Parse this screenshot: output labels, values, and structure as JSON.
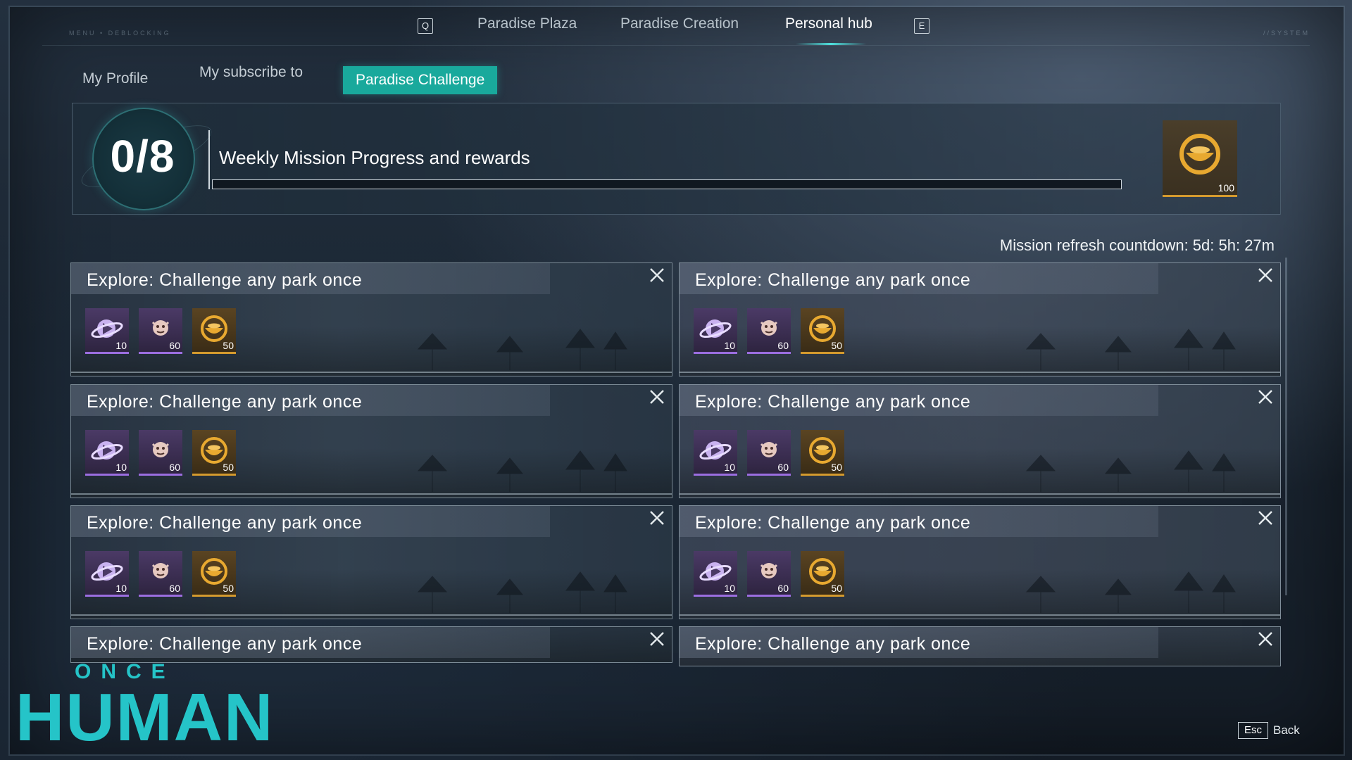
{
  "frame": {
    "left_tag": "MENU • DEBLOCKING",
    "right_tag": "//SYSTEM"
  },
  "top_nav": {
    "left_key": "Q",
    "right_key": "E",
    "tabs": [
      {
        "label": "Paradise Plaza",
        "active": false
      },
      {
        "label": "Paradise Creation",
        "active": false
      },
      {
        "label": "Personal hub",
        "active": true
      }
    ]
  },
  "sub_tabs": [
    {
      "label": "My Profile",
      "active": false
    },
    {
      "label": "My subscribe to",
      "active": false
    },
    {
      "label": "Paradise Challenge",
      "active": true
    }
  ],
  "weekly": {
    "count": "0/8",
    "completed": 0,
    "total": 8,
    "title": "Weekly Mission Progress and rewards",
    "reward_qty": "100",
    "reward_icon": "gold-coin-bowl-icon"
  },
  "countdown": "Mission refresh countdown: 5d: 5h: 27m",
  "missions": [
    {
      "title": "Explore: Challenge any park once",
      "rewards": [
        {
          "icon": "planet-play-icon",
          "qty": "10"
        },
        {
          "icon": "deviant-face-icon",
          "qty": "60"
        },
        {
          "icon": "gold-coin-bowl-icon",
          "qty": "50"
        }
      ]
    },
    {
      "title": "Explore: Challenge any park once",
      "rewards": [
        {
          "icon": "planet-play-icon",
          "qty": "10"
        },
        {
          "icon": "deviant-face-icon",
          "qty": "60"
        },
        {
          "icon": "gold-coin-bowl-icon",
          "qty": "50"
        }
      ]
    },
    {
      "title": "Explore: Challenge any park once",
      "rewards": [
        {
          "icon": "planet-play-icon",
          "qty": "10"
        },
        {
          "icon": "deviant-face-icon",
          "qty": "60"
        },
        {
          "icon": "gold-coin-bowl-icon",
          "qty": "50"
        }
      ]
    },
    {
      "title": "Explore: Challenge any park once",
      "rewards": [
        {
          "icon": "planet-play-icon",
          "qty": "10"
        },
        {
          "icon": "deviant-face-icon",
          "qty": "60"
        },
        {
          "icon": "gold-coin-bowl-icon",
          "qty": "50"
        }
      ]
    },
    {
      "title": "Explore: Challenge any park once",
      "rewards": [
        {
          "icon": "planet-play-icon",
          "qty": "10"
        },
        {
          "icon": "deviant-face-icon",
          "qty": "60"
        },
        {
          "icon": "gold-coin-bowl-icon",
          "qty": "50"
        }
      ]
    },
    {
      "title": "Explore: Challenge any park once",
      "rewards": [
        {
          "icon": "planet-play-icon",
          "qty": "10"
        },
        {
          "icon": "deviant-face-icon",
          "qty": "60"
        },
        {
          "icon": "gold-coin-bowl-icon",
          "qty": "50"
        }
      ]
    },
    {
      "title": "Explore: Challenge any park once",
      "rewards": []
    },
    {
      "title": "Explore: Challenge any park once",
      "rewards": []
    }
  ],
  "logo": {
    "line1": "ONCE",
    "line2": "HUMAN"
  },
  "footer": {
    "esc_key": "Esc",
    "back_label": "Back"
  },
  "colors": {
    "accent": "#19a99c",
    "accent_glow": "#4fe0dd",
    "gold": "#d49a2e",
    "purple": "#9b6ee0"
  }
}
